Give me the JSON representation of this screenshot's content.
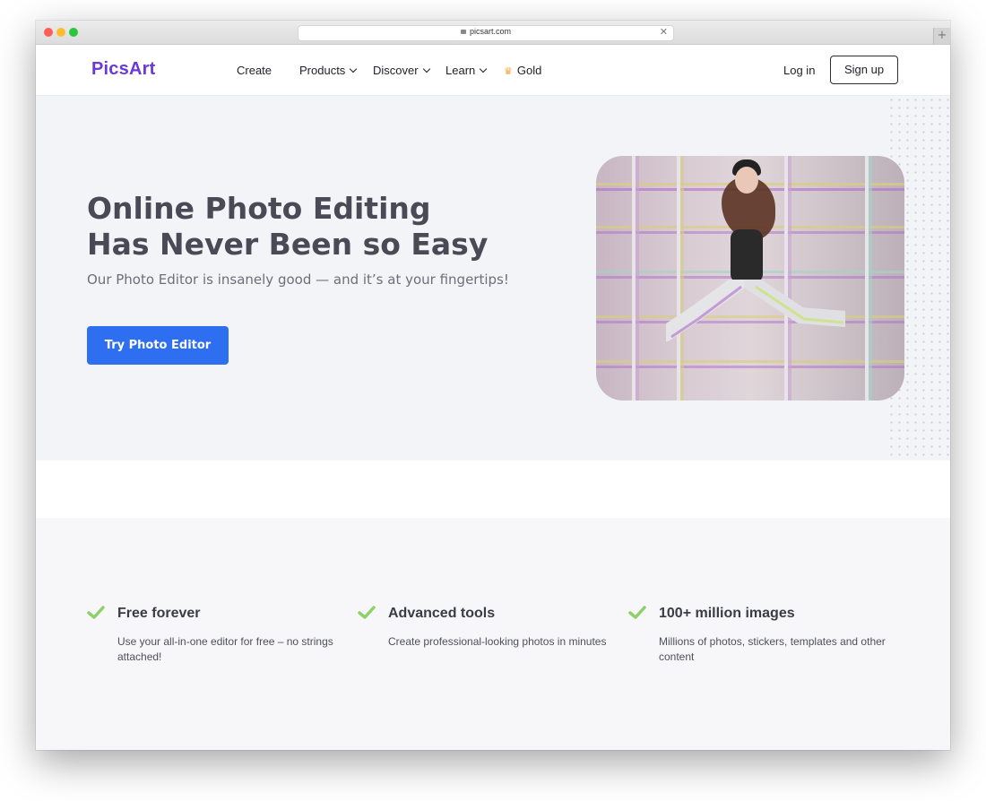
{
  "browser": {
    "url": "picsart.com",
    "new_tab_label": "+"
  },
  "nav": {
    "logo": "PicsArt",
    "items": [
      {
        "label": "Create",
        "dropdown": false
      },
      {
        "label": "Products",
        "dropdown": true
      },
      {
        "label": "Discover",
        "dropdown": true
      },
      {
        "label": "Learn",
        "dropdown": true
      },
      {
        "label": "Gold",
        "dropdown": false,
        "icon": "crown-icon"
      }
    ],
    "login_label": "Log in",
    "signup_label": "Sign up"
  },
  "hero": {
    "title": "Online Photo Editing Has Never Been so Easy",
    "subtitle": "Our Photo Editor is insanely good — and it’s at your fingertips!",
    "cta_label": "Try Photo Editor"
  },
  "features": [
    {
      "icon": "check-icon",
      "title": "Free forever",
      "description": "Use your all-in-one editor for free – no strings attached!"
    },
    {
      "icon": "check-icon",
      "title": "Advanced tools",
      "description": "Create professional-looking photos in minutes"
    },
    {
      "icon": "check-icon",
      "title": "100+ million images",
      "description": "Millions of photos, stickers, templates and other content"
    }
  ],
  "colors": {
    "brand": "#6b3ad6",
    "cta": "#2e6ef0",
    "check": "#8fd06a",
    "hero_bg": "#f3f4f8"
  }
}
